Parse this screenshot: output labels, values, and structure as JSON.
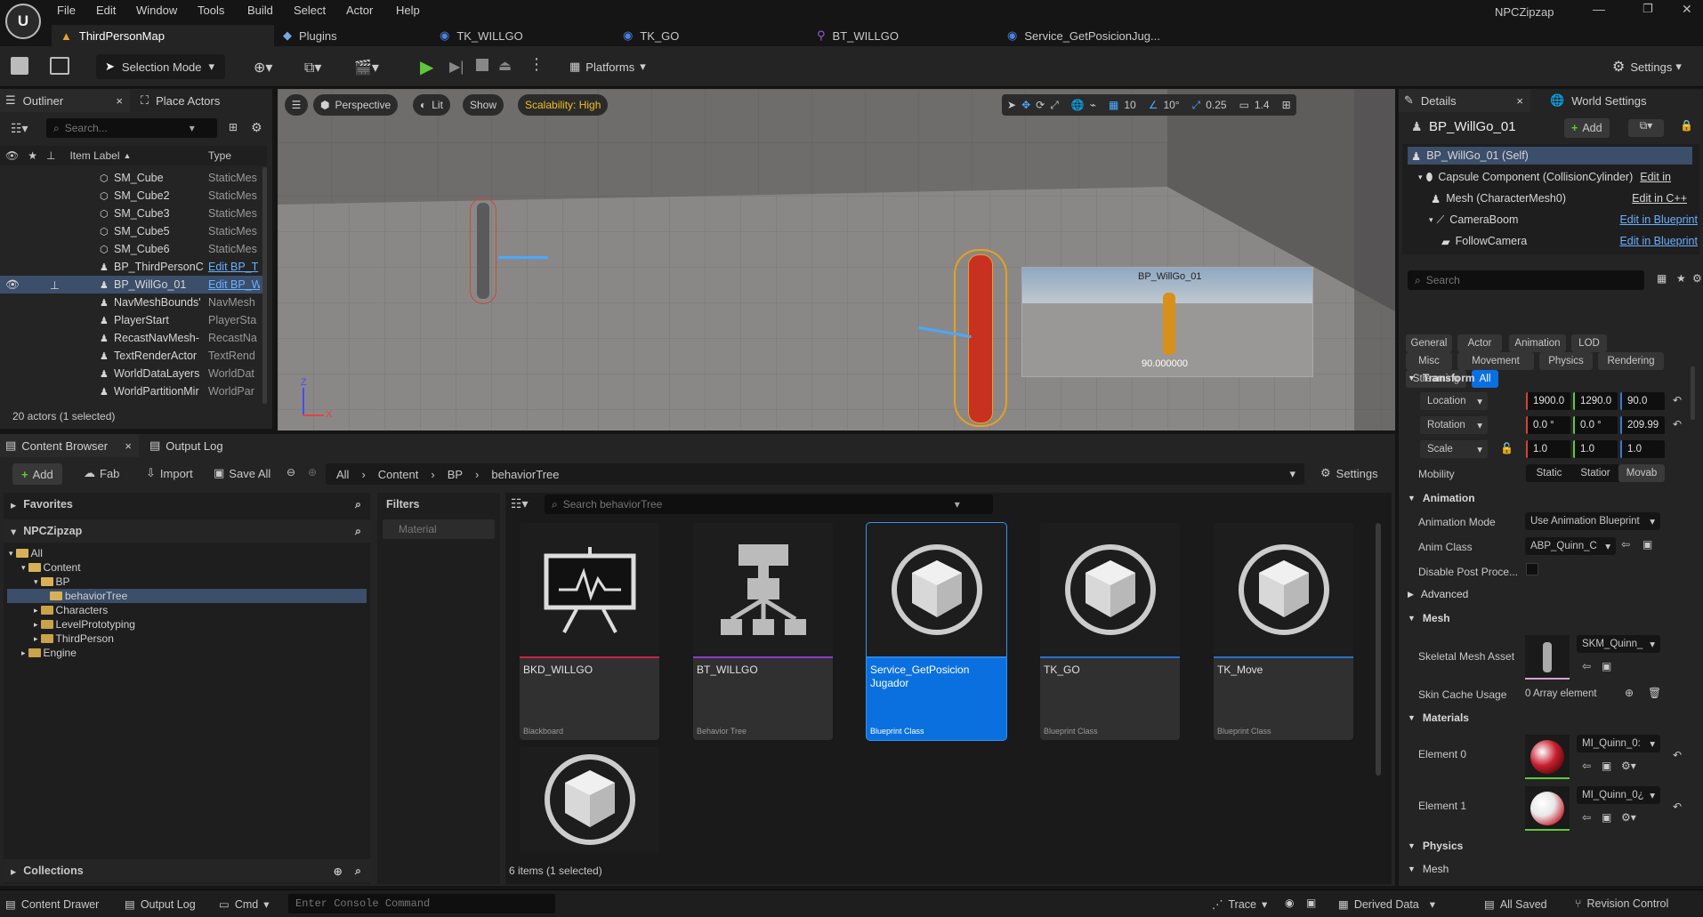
{
  "app": {
    "project_name": "NPCZipzap"
  },
  "menu": [
    "File",
    "Edit",
    "Window",
    "Tools",
    "Build",
    "Select",
    "Actor",
    "Help"
  ],
  "doc_tabs": [
    "ThirdPersonMap",
    "Plugins",
    "TK_WILLGO",
    "TK_GO",
    "BT_WILLGO",
    "Service_GetPosicionJug..."
  ],
  "toolbar": {
    "selection_mode": "Selection Mode",
    "platforms": "Platforms",
    "settings": "Settings"
  },
  "outliner": {
    "tab": "Outliner",
    "place_actors_tab": "Place Actors",
    "search_placeholder": "Search...",
    "col_label": "Item Label",
    "col_type": "Type",
    "rows": [
      {
        "label": "SM_Cube",
        "type": "StaticMes"
      },
      {
        "label": "SM_Cube2",
        "type": "StaticMes"
      },
      {
        "label": "SM_Cube3",
        "type": "StaticMes"
      },
      {
        "label": "SM_Cube5",
        "type": "StaticMes"
      },
      {
        "label": "SM_Cube6",
        "type": "StaticMes"
      },
      {
        "label": "BP_ThirdPersonC",
        "type": "Edit BP_T"
      },
      {
        "label": "BP_WillGo_01",
        "type": "Edit BP_W"
      },
      {
        "label": "NavMeshBounds'",
        "type": "NavMesh"
      },
      {
        "label": "PlayerStart",
        "type": "PlayerSta"
      },
      {
        "label": "RecastNavMesh-",
        "type": "RecastNa"
      },
      {
        "label": "TextRenderActor",
        "type": "TextRend"
      },
      {
        "label": "WorldDataLayers",
        "type": "WorldDat"
      },
      {
        "label": "WorldPartitionMir",
        "type": "WorldPar"
      }
    ],
    "status": "20 actors (1 selected)"
  },
  "viewport": {
    "perspective": "Perspective",
    "lit": "Lit",
    "show": "Show",
    "scalability": "Scalability: High",
    "grid_snap": "10",
    "rot_snap": "10°",
    "scale_snap": "0.25",
    "camera_speed": "1.4",
    "preview_title": "BP_WillGo_01",
    "preview_value": "90.000000",
    "axis_z": "Z",
    "axis_x": "X"
  },
  "content_browser": {
    "tab": "Content Browser",
    "output_log_tab": "Output Log",
    "add": "Add",
    "fab": "Fab",
    "import": "Import",
    "save_all": "Save All",
    "breadcrumb": [
      "All",
      "Content",
      "BP",
      "behaviorTree"
    ],
    "settings": "Settings",
    "favorites": "Favorites",
    "project": "NPCZipzap",
    "tree": [
      "All",
      "Content",
      "BP",
      "behaviorTree",
      "Characters",
      "LevelPrototyping",
      "ThirdPerson",
      "Engine"
    ],
    "collections": "Collections",
    "filters": "Filters",
    "filter_material": "Material",
    "search_placeholder": "Search behaviorTree",
    "assets": [
      {
        "name": "BKD_WILLGO",
        "kind": "Blackboard",
        "color": "#c8224a"
      },
      {
        "name": "BT_WILLGO",
        "kind": "Behavior Tree",
        "color": "#8a3cc8"
      },
      {
        "name": "Service_GetPosicion Jugador",
        "kind": "Blueprint Class",
        "color": "#2a82e8"
      },
      {
        "name": "TK_GO",
        "kind": "Blueprint Class",
        "color": "#2a6fd0"
      },
      {
        "name": "TK_Move",
        "kind": "Blueprint Class",
        "color": "#2a6fd0"
      }
    ],
    "status": "6 items (1 selected)"
  },
  "details": {
    "tab": "Details",
    "world_settings_tab": "World Settings",
    "object_name": "BP_WillGo_01",
    "add": "Add",
    "components": [
      {
        "name": "BP_WillGo_01 (Self)",
        "link": ""
      },
      {
        "name": "Capsule Component (CollisionCylinder)",
        "link": "Edit in"
      },
      {
        "name": "Mesh (CharacterMesh0)",
        "link": "Edit in C++"
      },
      {
        "name": "CameraBoom",
        "link": "Edit in Blueprint"
      },
      {
        "name": "FollowCamera",
        "link": "Edit in Blueprint"
      }
    ],
    "search_placeholder": "Search",
    "categories": [
      "General",
      "Actor",
      "Animation",
      "LOD",
      "Misc",
      "Movement",
      "Physics",
      "Rendering",
      "Streaming",
      "All"
    ],
    "transform": {
      "header": "Transform",
      "location_label": "Location",
      "location": [
        "1900.0",
        "1290.0",
        "90.0"
      ],
      "rotation_label": "Rotation",
      "rotation": [
        "0.0 °",
        "0.0 °",
        "209.99"
      ],
      "scale_label": "Scale",
      "scale": [
        "1.0",
        "1.0",
        "1.0"
      ],
      "mobility_label": "Mobility",
      "mobility_options": [
        "Static",
        "Statior",
        "Movab"
      ]
    },
    "animation": {
      "header": "Animation",
      "mode_label": "Animation Mode",
      "mode_value": "Use Animation Blueprint",
      "class_label": "Anim Class",
      "class_value": "ABP_Quinn_C",
      "disable_label": "Disable Post Proce...",
      "advanced": "Advanced"
    },
    "mesh": {
      "header": "Mesh",
      "skeletal_label": "Skeletal Mesh Asset",
      "skeletal_value": "SKM_Quinn_",
      "skin_cache_label": "Skin Cache Usage",
      "skin_cache_value": "0 Array element"
    },
    "materials": {
      "header": "Materials",
      "element0_label": "Element 0",
      "element0_value": "MI_Quinn_0:",
      "element1_label": "Element 1",
      "element1_value": "MI_Quinn_0¿"
    },
    "physics_header": "Physics",
    "mesh2_header": "Mesh"
  },
  "statusbar": {
    "content_drawer": "Content Drawer",
    "output_log": "Output Log",
    "cmd": "Cmd",
    "console_placeholder": "Enter Console Command",
    "trace": "Trace",
    "derived_data": "Derived Data",
    "all_saved": "All Saved",
    "revision_control": "Revision Control"
  }
}
